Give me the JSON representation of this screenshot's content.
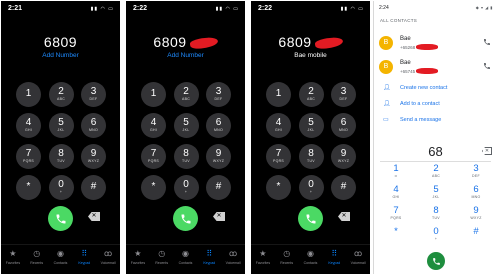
{
  "ios_panels": [
    {
      "time": "2:21",
      "number": "6809",
      "number_redacted": false,
      "sub_text": "Add Number",
      "sub_style": "link"
    },
    {
      "time": "2:22",
      "number": "6809",
      "number_redacted": true,
      "sub_text": "Add Number",
      "sub_style": "link"
    },
    {
      "time": "2:22",
      "number": "6809",
      "number_redacted": true,
      "sub_text": "Bae mobile",
      "sub_style": "plain"
    }
  ],
  "ios_keypad": [
    {
      "digit": "1",
      "letters": ""
    },
    {
      "digit": "2",
      "letters": "ABC"
    },
    {
      "digit": "3",
      "letters": "DEF"
    },
    {
      "digit": "4",
      "letters": "GHI"
    },
    {
      "digit": "5",
      "letters": "JKL"
    },
    {
      "digit": "6",
      "letters": "MNO"
    },
    {
      "digit": "7",
      "letters": "PQRS"
    },
    {
      "digit": "8",
      "letters": "TUV"
    },
    {
      "digit": "9",
      "letters": "WXYZ"
    },
    {
      "digit": "*",
      "letters": ""
    },
    {
      "digit": "0",
      "letters": "+"
    },
    {
      "digit": "#",
      "letters": ""
    }
  ],
  "ios_tabs": [
    {
      "label": "Favorites",
      "icon": "star-icon"
    },
    {
      "label": "Recents",
      "icon": "clock-icon"
    },
    {
      "label": "Contacts",
      "icon": "person-icon"
    },
    {
      "label": "Keypad",
      "icon": "keypad-icon",
      "active": true
    },
    {
      "label": "Voicemail",
      "icon": "voicemail-icon"
    }
  ],
  "android": {
    "time": "2:24",
    "section_header": "ALL CONTACTS",
    "contacts": [
      {
        "initial": "B",
        "name": "Bae",
        "number_prefix": "+65268"
      },
      {
        "initial": "B",
        "name": "Bae",
        "number_prefix": "+65745"
      }
    ],
    "actions": [
      {
        "label": "Create new contact",
        "icon": "person-add-icon"
      },
      {
        "label": "Add to a contact",
        "icon": "person-add-icon"
      },
      {
        "label": "Send a message",
        "icon": "message-icon"
      }
    ],
    "typed_number": "68",
    "keypad": [
      {
        "digit": "1",
        "letters": "∞"
      },
      {
        "digit": "2",
        "letters": "ABC"
      },
      {
        "digit": "3",
        "letters": "DEF"
      },
      {
        "digit": "4",
        "letters": "GHI"
      },
      {
        "digit": "5",
        "letters": "JKL"
      },
      {
        "digit": "6",
        "letters": "MNO"
      },
      {
        "digit": "7",
        "letters": "PQRS"
      },
      {
        "digit": "8",
        "letters": "TUV"
      },
      {
        "digit": "9",
        "letters": "WXYZ"
      },
      {
        "digit": "*",
        "letters": ""
      },
      {
        "digit": "0",
        "letters": "+"
      },
      {
        "digit": "#",
        "letters": ""
      }
    ]
  },
  "colors": {
    "ios_link": "#1e8bff",
    "ios_call": "#4bd964",
    "redaction": "#e31b23",
    "android_accent": "#1a73e8",
    "android_avatar": "#f4b400",
    "android_call": "#1e8e3e"
  }
}
